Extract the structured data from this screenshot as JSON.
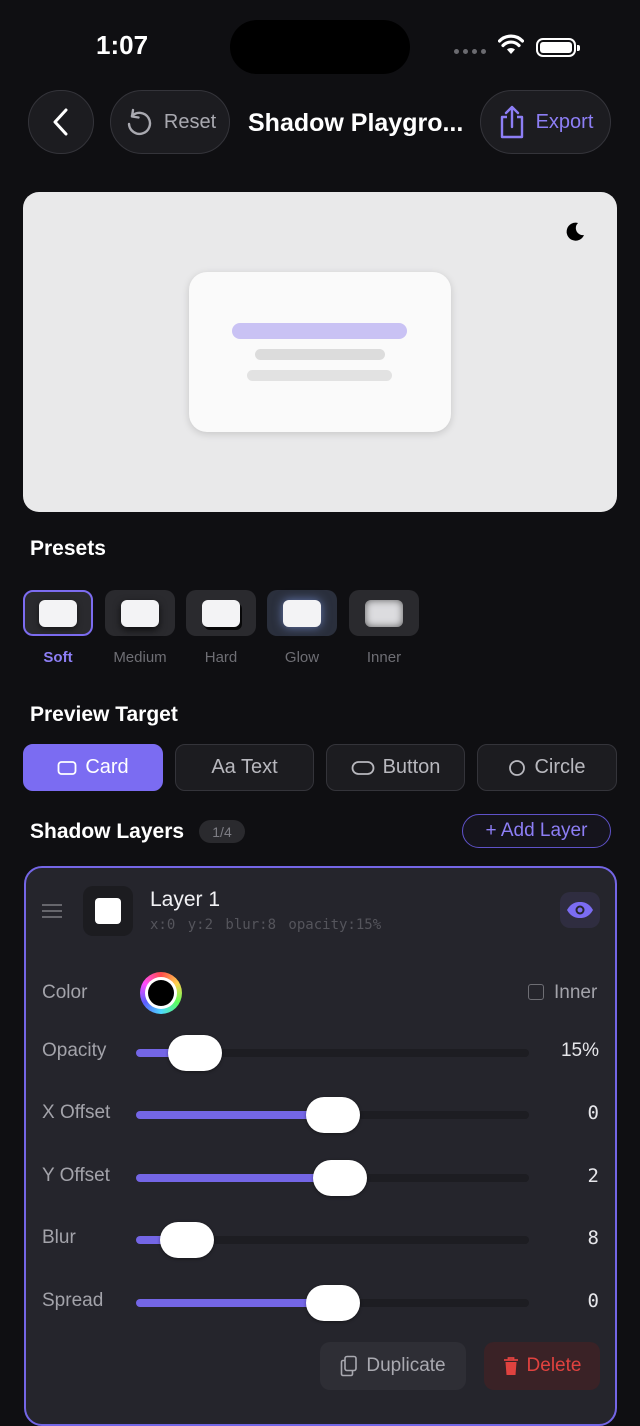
{
  "status_bar": {
    "time": "1:07"
  },
  "header": {
    "reset_label": "Reset",
    "title": "Shadow Playgro...",
    "export_label": "Export"
  },
  "presets": {
    "heading": "Presets",
    "items": [
      {
        "label": "Soft",
        "selected": true
      },
      {
        "label": "Medium",
        "selected": false
      },
      {
        "label": "Hard",
        "selected": false
      },
      {
        "label": "Glow",
        "selected": false
      },
      {
        "label": "Inner",
        "selected": false
      }
    ]
  },
  "preview_target": {
    "heading": "Preview Target",
    "options": [
      {
        "label": "Card",
        "selected": true
      },
      {
        "label": "Aa Text",
        "selected": false
      },
      {
        "label": "Button",
        "selected": false
      },
      {
        "label": "Circle",
        "selected": false
      }
    ]
  },
  "layers": {
    "heading": "Shadow Layers",
    "count": "1/4",
    "add_label": "+ Add Layer",
    "current": {
      "name": "Layer 1",
      "meta": "x:0  y:2  blur:8  opacity:15%",
      "color_label": "Color",
      "color": "#000000",
      "inner_label": "Inner",
      "inner_checked": false,
      "sliders": [
        {
          "label": "Opacity",
          "value": "15%",
          "fraction": 0.15
        },
        {
          "label": "X Offset",
          "value": "0",
          "fraction": 0.5
        },
        {
          "label": "Y Offset",
          "value": "2",
          "fraction": 0.52
        },
        {
          "label": "Blur",
          "value": "8",
          "fraction": 0.13
        },
        {
          "label": "Spread",
          "value": "0",
          "fraction": 0.5
        }
      ],
      "duplicate_label": "Duplicate",
      "delete_label": "Delete"
    }
  },
  "colors": {
    "accent": "#7b6cf2",
    "danger": "#e0423f",
    "background": "#0f0f12",
    "panel": "#25252c"
  }
}
